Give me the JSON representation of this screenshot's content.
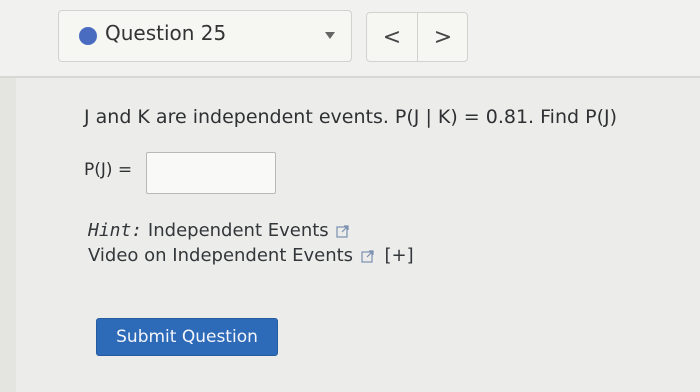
{
  "question_selector": {
    "label": "Question 25"
  },
  "nav": {
    "prev": "<",
    "next": ">"
  },
  "question": {
    "text": "J and K are independent events. P(J | K) = 0.81. Find P(J)",
    "answer_label": "P(J) =",
    "answer_value": ""
  },
  "hints": {
    "hint_prefix": "Hint:",
    "hint_link": "Independent Events",
    "video_link": "Video on Independent Events",
    "expand": "[+]"
  },
  "submit": {
    "label": "Submit Question"
  },
  "colors": {
    "dot": "#4a6cc0",
    "button": "#2d6ab8"
  }
}
